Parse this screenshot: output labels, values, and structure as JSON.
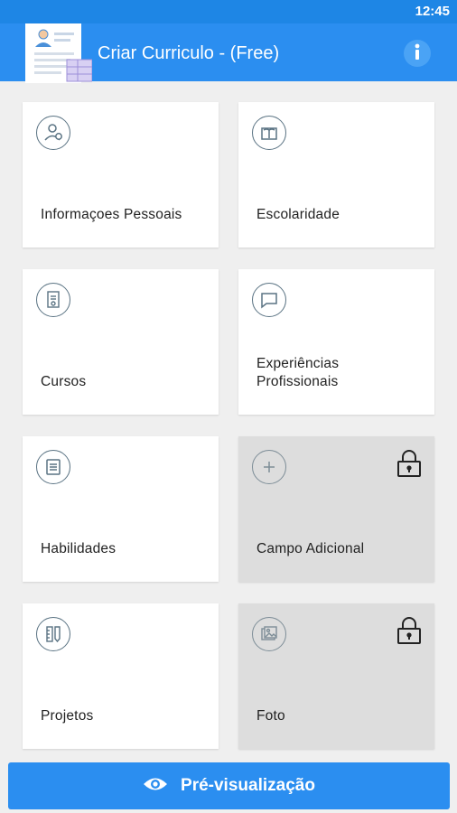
{
  "status_bar": {
    "time": "12:45"
  },
  "app_bar": {
    "title": "Criar Curriculo - (Free)",
    "info_icon": "info-icon"
  },
  "cards": [
    {
      "label": "Informaçoes Pessoais",
      "icon": "person-icon",
      "locked": false
    },
    {
      "label": "Escolaridade",
      "icon": "book-icon",
      "locked": false
    },
    {
      "label": "Cursos",
      "icon": "certificate-icon",
      "locked": false
    },
    {
      "label": "Experiências\nProfissionais",
      "icon": "chat-bubble-icon",
      "locked": false
    },
    {
      "label": "Habilidades",
      "icon": "list-icon",
      "locked": false
    },
    {
      "label": "Campo Adicional",
      "icon": "plus-icon",
      "locked": true
    },
    {
      "label": "Projetos",
      "icon": "pencil-ruler-icon",
      "locked": false
    },
    {
      "label": "Foto",
      "icon": "photo-icon",
      "locked": true
    }
  ],
  "preview_button": {
    "label": "Pré-visualização",
    "icon": "eye-icon"
  },
  "colors": {
    "primary": "#2b8ef0",
    "status_bar": "#1e86e5",
    "background": "#efefef",
    "card": "#ffffff",
    "locked_card": "#dddddd",
    "icon_stroke": "#5a7383"
  }
}
